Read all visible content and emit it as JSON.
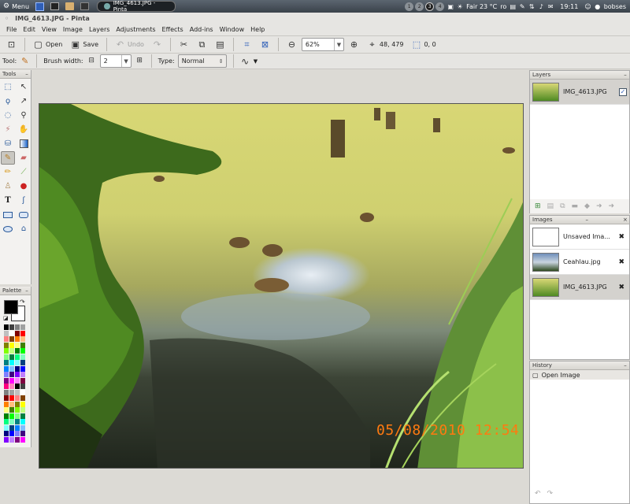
{
  "system_panel": {
    "menu_label": "Menu",
    "task_title": "IMG_4613.JPG - Pinta",
    "workspaces": [
      "1",
      "2",
      "3",
      "4"
    ],
    "weather": "Fair 23 °C",
    "keyboard": "ro",
    "clock": "19:11",
    "user": "bobses"
  },
  "window": {
    "title": "IMG_4613.JPG - Pinta"
  },
  "menu": [
    "File",
    "Edit",
    "View",
    "Image",
    "Layers",
    "Adjustments",
    "Effects",
    "Add-ins",
    "Window",
    "Help"
  ],
  "toolbar": {
    "open_label": "Open",
    "save_label": "Save",
    "undo_label": "Undo",
    "zoom_value": "62%",
    "cursor_pos": "48, 479",
    "selection_size": "0, 0"
  },
  "tool_options": {
    "tool_label": "Tool:",
    "brush_width_label": "Brush width:",
    "brush_width_value": "2",
    "type_label": "Type:",
    "type_value": "Normal"
  },
  "tools": {
    "title": "Tools",
    "items": [
      "rectangle-select",
      "move-selected",
      "lasso-select",
      "move-selection",
      "ellipse-select",
      "zoom",
      "magic-wand",
      "pan",
      "paint-bucket",
      "gradient",
      "paintbrush",
      "eraser",
      "pencil",
      "color-picker",
      "clone-stamp",
      "recolor",
      "text",
      "line-curve",
      "rectangle",
      "rounded-rectangle",
      "ellipse",
      "freeform-shape"
    ]
  },
  "palette": {
    "title": "Palette",
    "primary_color": "#000000",
    "secondary_color": "#ffffff"
  },
  "layers": {
    "title": "Layers",
    "items": [
      {
        "name": "IMG_4613.JPG",
        "visible": true
      }
    ]
  },
  "images": {
    "title": "Images",
    "items": [
      {
        "name": "Unsaved Ima...",
        "thumb": "blank"
      },
      {
        "name": "Ceahlau.jpg",
        "thumb": "mountain"
      },
      {
        "name": "IMG_4613.JPG",
        "thumb": "pond"
      }
    ]
  },
  "history": {
    "title": "History",
    "items": [
      "Open Image"
    ]
  },
  "photo": {
    "date_stamp": "05/08/2010  12:54"
  }
}
